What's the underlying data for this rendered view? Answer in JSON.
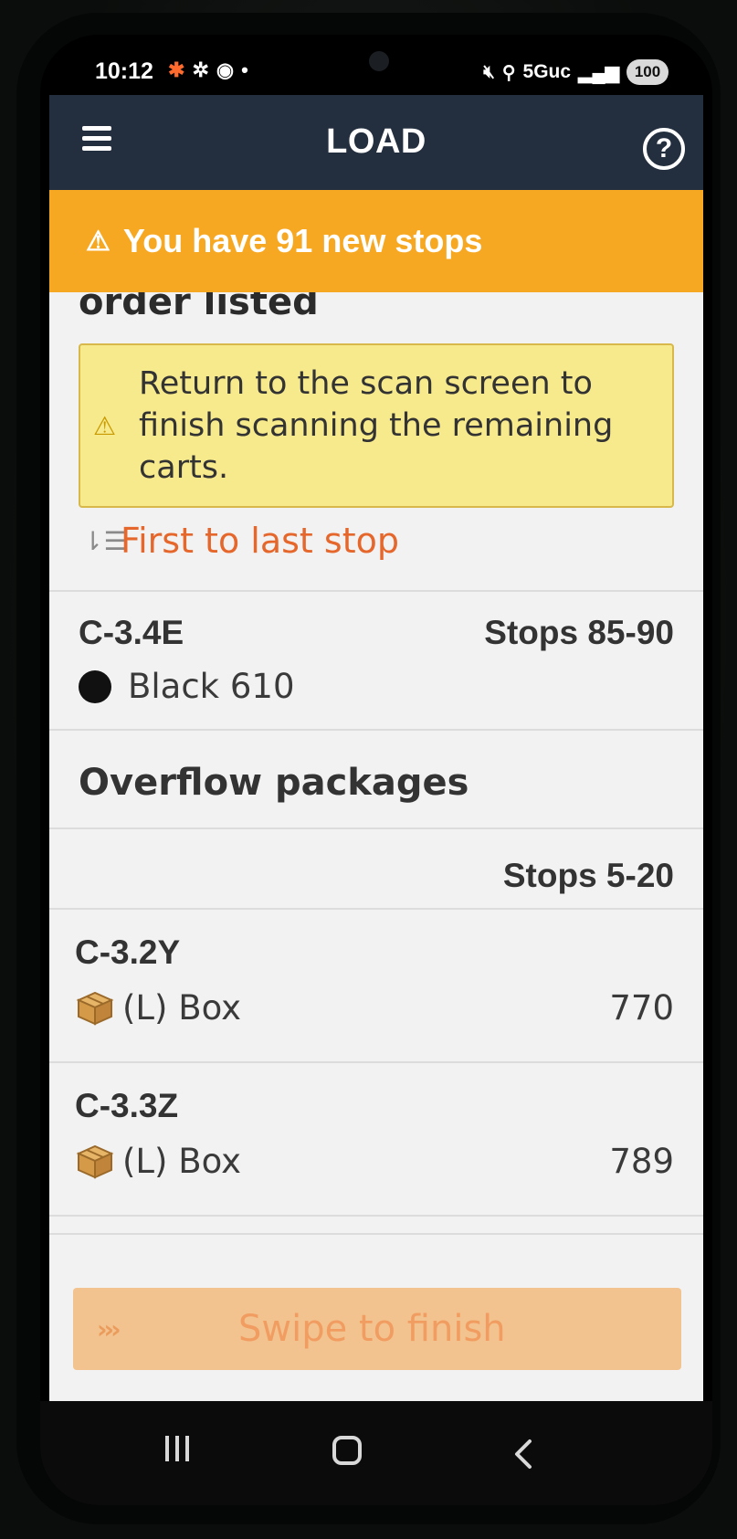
{
  "status_bar": {
    "time": "10:12",
    "network": "5Guc",
    "battery": "100"
  },
  "header": {
    "title": "LOAD",
    "help_symbol": "?"
  },
  "banner": {
    "text": "You have 91 new stops",
    "color": "#f7a823"
  },
  "content": {
    "cut_heading": "order listed",
    "info_box_text_line1": "Return to the scan screen to",
    "info_box_text_line2": "finish scanning the remaining",
    "info_box_text_line3": "carts.",
    "sort_label": "First to last stop",
    "carts": [
      {
        "id": "C-3.4E",
        "stops": "Stops 85-90",
        "bag_color_label": "Black 610",
        "bag_color": "#111111"
      }
    ],
    "overflow": {
      "title": "Overflow packages",
      "stops": "Stops 5-20",
      "items": [
        {
          "id": "C-3.2Y",
          "type": "(L) Box",
          "count": "770"
        },
        {
          "id": "C-3.3Z",
          "type": "(L) Box",
          "count": "789"
        }
      ]
    }
  },
  "swipe": {
    "chevrons": "›››",
    "label": "Swipe to finish"
  },
  "colors": {
    "header_bg": "#232f3e",
    "accent_orange": "#e5672c",
    "info_box_bg": "#f7ea8c"
  }
}
